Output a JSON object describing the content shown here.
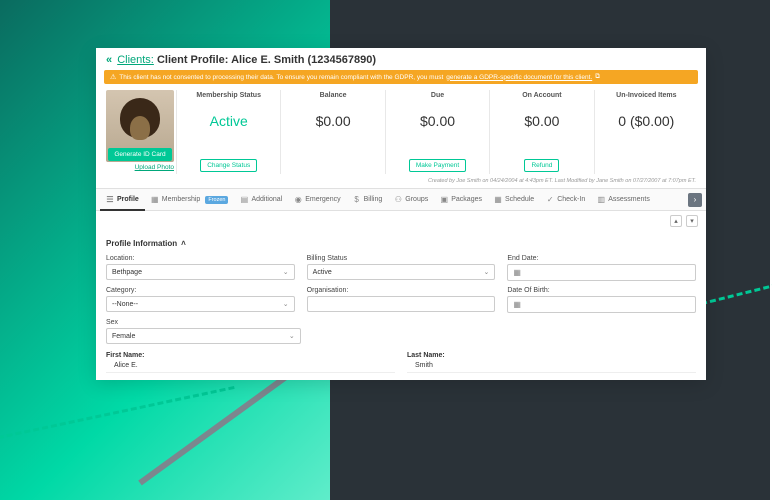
{
  "header": {
    "back_label": "Clients:",
    "title": "Client Profile: Alice E. Smith (1234567890)"
  },
  "gdpr": {
    "text": "This client has not consented to processing their data. To ensure you remain compliant with the GDPR, you must",
    "link": "generate a GDPR-specific document for this client."
  },
  "photo": {
    "generate_btn": "Generate ID Card",
    "upload_link": "Upload Photo"
  },
  "stats": [
    {
      "label": "Membership Status",
      "value": "Active",
      "value_class": "active",
      "btn": "Change Status"
    },
    {
      "label": "Balance",
      "value": "$0.00",
      "btn": ""
    },
    {
      "label": "Due",
      "value": "$0.00",
      "btn": "Make Payment"
    },
    {
      "label": "On Account",
      "value": "$0.00",
      "btn": "Refund"
    },
    {
      "label": "Un-Invoiced Items",
      "value": "0 ($0.00)",
      "btn": ""
    }
  ],
  "audit": "Created by Joe Smith on 04/24/2004 at 4:43pm ET. Last Modified by Jane Smith on 07/27/2007 at 7:07pm ET.",
  "tabs": [
    {
      "icon": "user-icon",
      "glyph": "☰",
      "label": "Profile",
      "active": true
    },
    {
      "icon": "card-icon",
      "glyph": "▦",
      "label": "Membership",
      "badge": "Frozen"
    },
    {
      "icon": "info-icon",
      "glyph": "▤",
      "label": "Additional"
    },
    {
      "icon": "camera-icon",
      "glyph": "◉",
      "label": "Emergency"
    },
    {
      "icon": "dollar-icon",
      "glyph": "$",
      "label": "Billing"
    },
    {
      "icon": "groups-icon",
      "glyph": "⚇",
      "label": "Groups"
    },
    {
      "icon": "package-icon",
      "glyph": "▣",
      "label": "Packages"
    },
    {
      "icon": "calendar-icon",
      "glyph": "▦",
      "label": "Schedule"
    },
    {
      "icon": "check-icon",
      "glyph": "✓",
      "label": "Check-In"
    },
    {
      "icon": "assess-icon",
      "glyph": "▥",
      "label": "Assessments"
    }
  ],
  "section_title": "Profile Information",
  "fields": {
    "location": {
      "label": "Location:",
      "value": "Bethpage"
    },
    "billing_status": {
      "label": "Billing Status",
      "value": "Active"
    },
    "end_date": {
      "label": "End Date:",
      "value": ""
    },
    "category": {
      "label": "Category:",
      "value": "--None--"
    },
    "organisation": {
      "label": "Organisation:",
      "value": ""
    },
    "dob": {
      "label": "Date Of Birth:",
      "value": ""
    },
    "sex": {
      "label": "Sex",
      "value": "Female"
    },
    "first_name": {
      "label": "First Name:",
      "value": "Alice E."
    },
    "last_name": {
      "label": "Last Name:",
      "value": "Smith"
    }
  }
}
